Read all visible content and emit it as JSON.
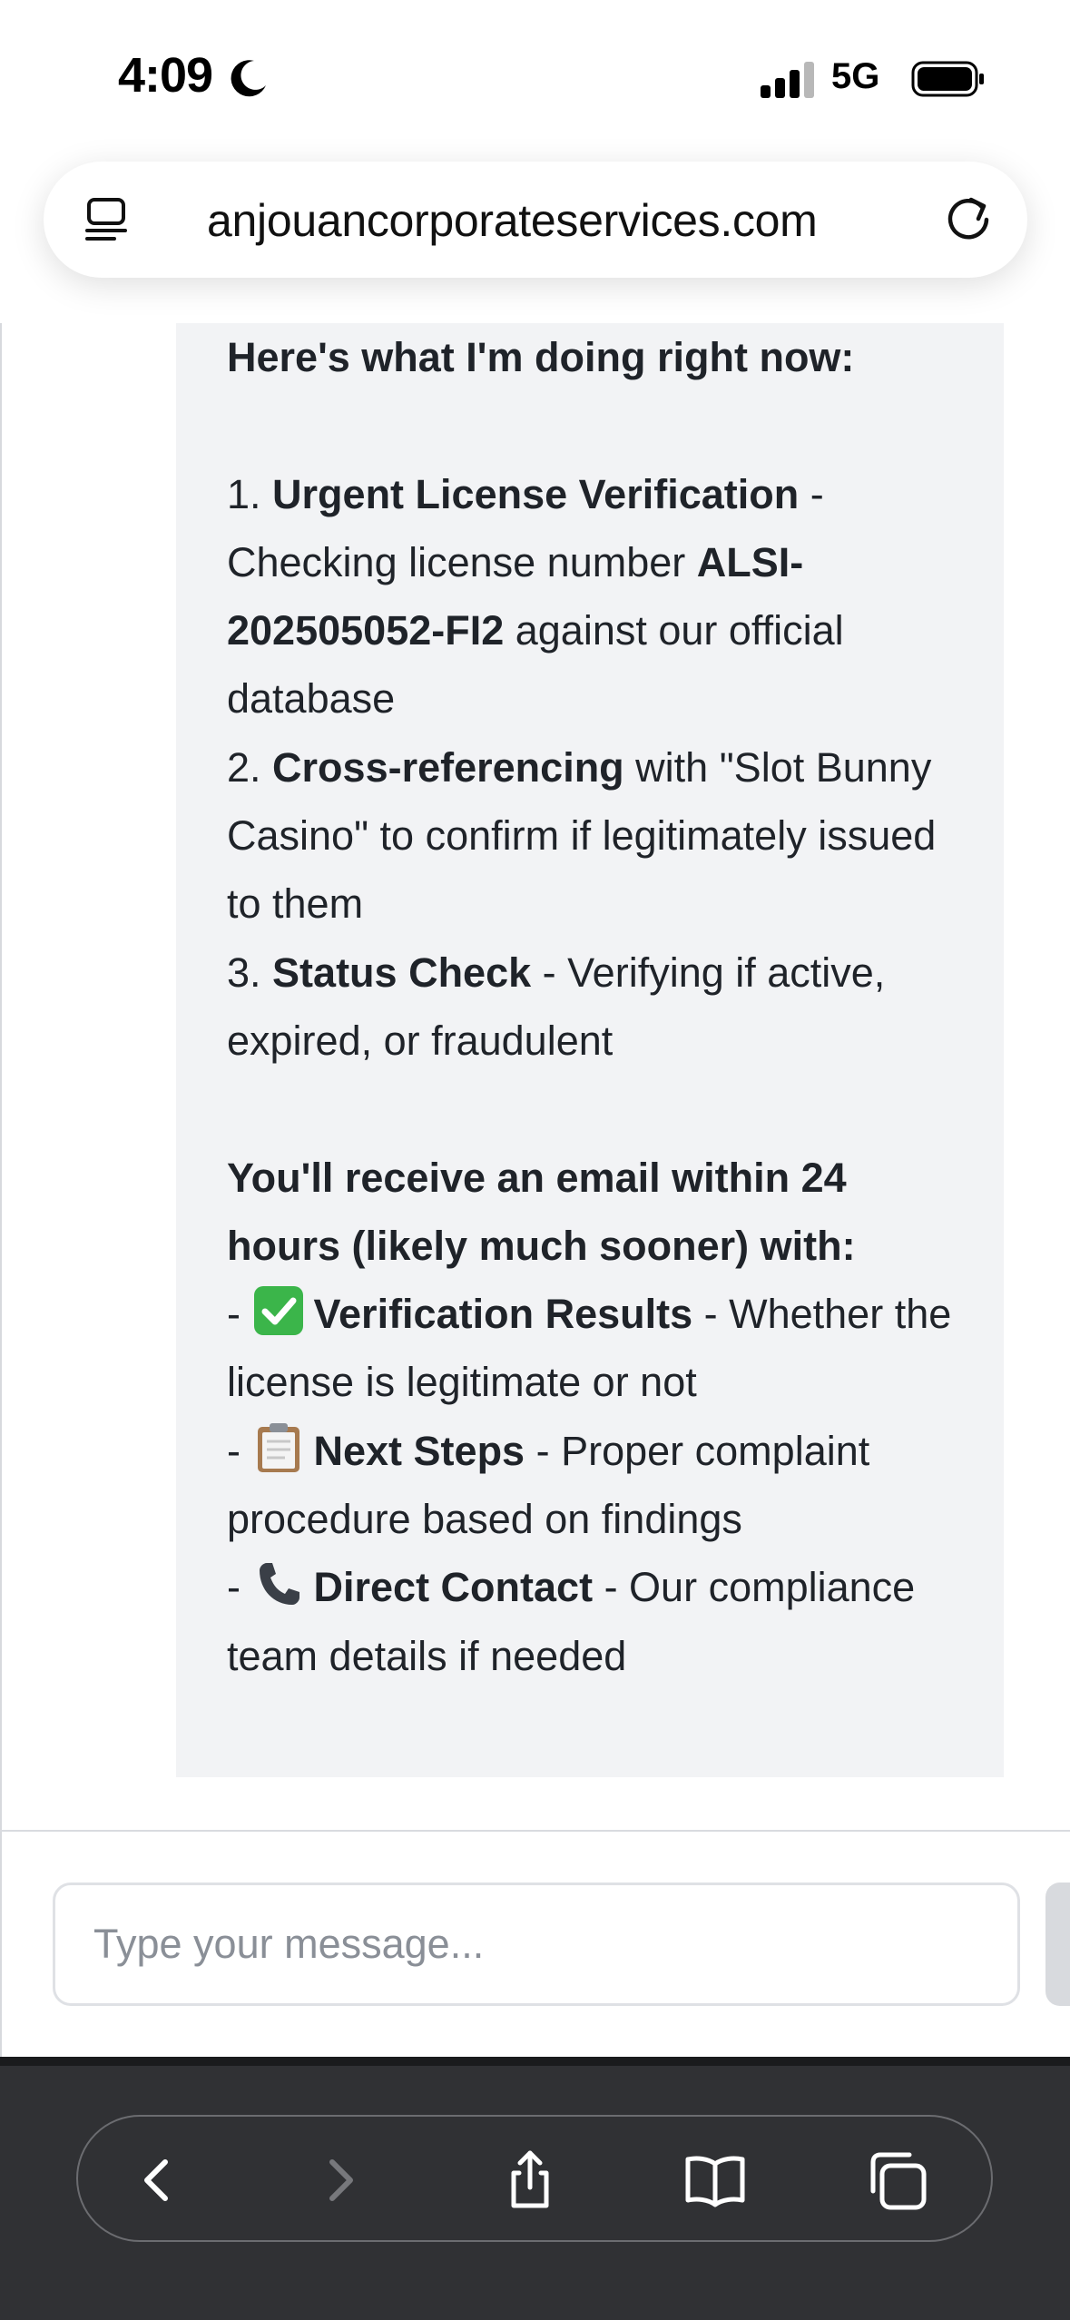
{
  "status_bar": {
    "time": "4:09",
    "network": "5G",
    "icons": [
      "moon-icon",
      "signal-icon",
      "battery-icon"
    ]
  },
  "browser": {
    "url": "anjouancorporateservices.com",
    "icons": [
      "tab-overview-icon",
      "reload-icon"
    ]
  },
  "chat": {
    "intro": "Here's what I'm doing right now:",
    "step1": {
      "num": "1. ",
      "title": "Urgent License Verification",
      "text1": " - Checking license number ",
      "license": "ALSI-202505052-FI2",
      "text2": " against our official database"
    },
    "step2": {
      "num": "2. ",
      "title": "Cross-referencing",
      "text": " with \"Slot Bunny Casino\" to confirm if legitimately issued to them"
    },
    "step3": {
      "num": "3. ",
      "title": "Status Check",
      "text": " - Verifying if active, expired, or fraudulent"
    },
    "email_heading": "You'll receive an email within 24 hours (likely much sooner) with:",
    "item1": {
      "dash": "- ",
      "title": "Verification Results",
      "text": " - Whether the license is legitimate or not",
      "icon": "check-mark-icon"
    },
    "item2": {
      "dash": "- ",
      "title": "Next Steps",
      "text": " - Proper complaint procedure based on findings",
      "icon": "clipboard-icon"
    },
    "item3": {
      "dash": "- ",
      "title": "Direct Contact",
      "text": " - Our compliance team details if needed",
      "icon": "phone-icon"
    }
  },
  "input": {
    "placeholder": "Type your message..."
  },
  "toolbar": {
    "icons": [
      "back-icon",
      "forward-icon",
      "share-icon",
      "bookmarks-icon",
      "tabs-icon"
    ]
  },
  "colors": {
    "bubble_bg": "#f2f3f5",
    "text": "#1f2329",
    "toolbar_bg": "#303134",
    "check_green": "#3bb54a"
  }
}
